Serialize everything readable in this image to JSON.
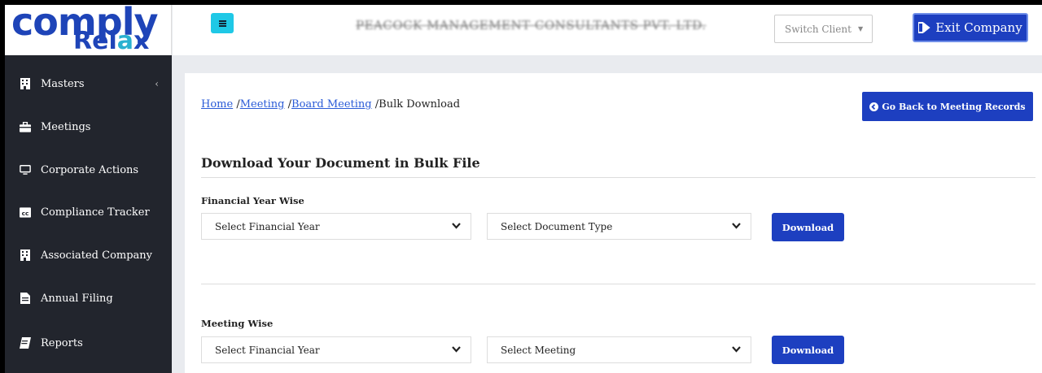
{
  "logo": {
    "line1": "comply",
    "line2_a": "Rel",
    "line2_b": "a",
    "line2_c": "x"
  },
  "header": {
    "company_name": "PEACOCK MANAGEMENT CONSULTANTS PVT. LTD.",
    "switch_client": "Switch Client",
    "exit_label": "Exit Company"
  },
  "sidebar": {
    "items": [
      {
        "label": "Masters",
        "icon": "building-icon"
      },
      {
        "label": "Meetings",
        "icon": "briefcase-icon"
      },
      {
        "label": "Corporate Actions",
        "icon": "monitor-icon"
      },
      {
        "label": "Compliance Tracker",
        "icon": "cc-icon"
      },
      {
        "label": "Associated Company",
        "icon": "building-icon"
      },
      {
        "label": "Annual Filing",
        "icon": "file-icon"
      },
      {
        "label": "Reports",
        "icon": "book-icon"
      }
    ]
  },
  "breadcrumb": {
    "home": "Home",
    "meeting": "Meeting",
    "board_meeting": "Board Meeting",
    "current": "Bulk Download",
    "sep": "/"
  },
  "go_back_label": "Go Back to Meeting Records",
  "section_title": "Download Your Document in Bulk File",
  "financial_year_wise": {
    "label": "Financial Year Wise",
    "year_select": "Select Financial Year",
    "doc_type_select": "Select Document Type",
    "download_label": "Download"
  },
  "meeting_wise": {
    "label": "Meeting Wise",
    "year_select": "Select Financial Year",
    "meeting_select": "Select Meeting",
    "download_label": "Download"
  },
  "colors": {
    "accent": "#1d3fc0",
    "sidebar_bg": "#22252d",
    "menu_btn": "#1fc8e6",
    "link": "#2a5bd7"
  }
}
